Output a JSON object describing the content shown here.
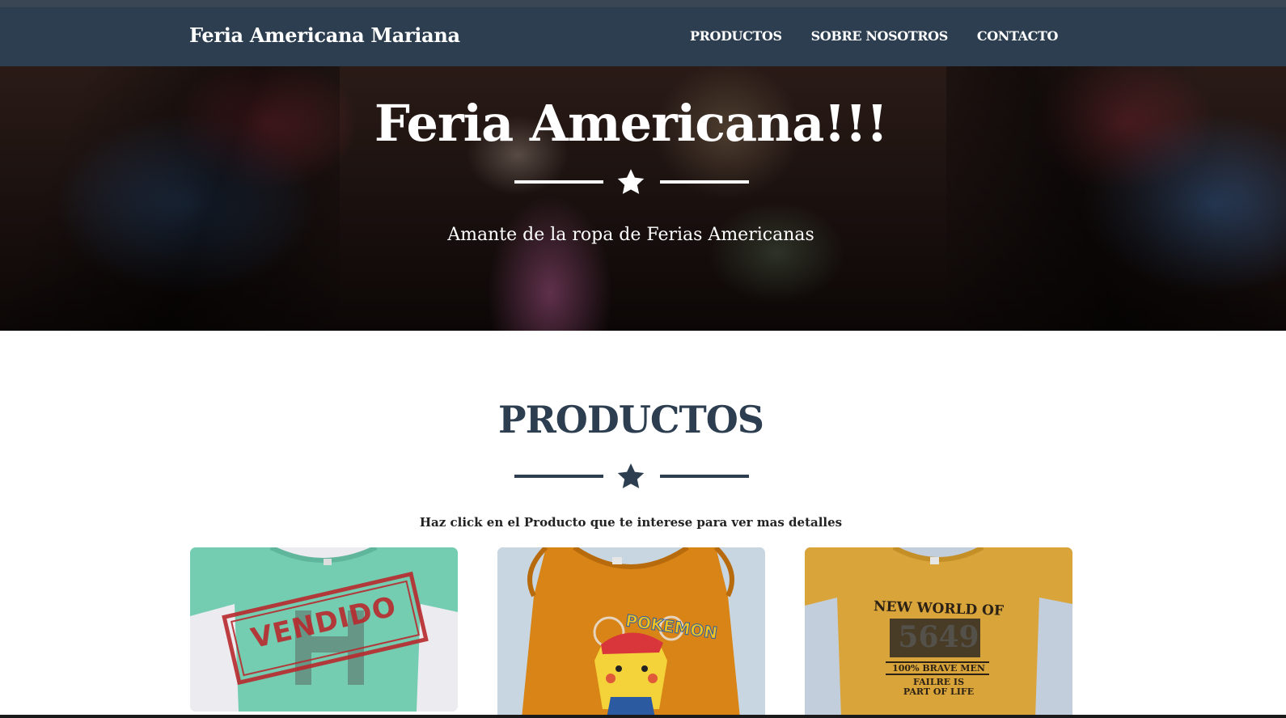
{
  "navbar": {
    "brand": "Feria Americana Mariana",
    "links": [
      {
        "label": "PRODUCTOS"
      },
      {
        "label": "SOBRE NOSOTROS"
      },
      {
        "label": "CONTACTO"
      }
    ]
  },
  "hero": {
    "title": "Feria Americana!!!",
    "subtitle": "Amante de la ropa de Ferias Americanas",
    "divider_icon": "star-icon"
  },
  "products_section": {
    "title": "PRODUCTOS",
    "divider_icon": "star-icon",
    "intro": "Haz click en el Producto que te interese para ver mas detalles",
    "items": [
      {
        "image": "green-tshirt-sold",
        "stamp": "VENDIDO"
      },
      {
        "image": "orange-tank-pokemon-pikachu",
        "print_text": "POKEMON"
      },
      {
        "image": "mustard-tshirt-new-world",
        "print_lines": [
          "NEW WORLD OF",
          "5649",
          "100% BRAVE MEN",
          "FAILRE IS",
          "PART OF LIFE"
        ]
      }
    ]
  },
  "colors": {
    "navbar_bg": "#2c3e50",
    "heading": "#2c3e50",
    "stamp_red": "#b92a2e"
  }
}
